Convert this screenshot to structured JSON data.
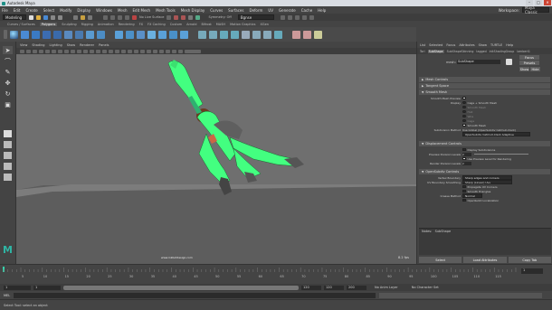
{
  "window": {
    "title": "Autodesk Maya",
    "min": "–",
    "max": "□",
    "close": "✕"
  },
  "menubar": {
    "items": [
      "File",
      "Edit",
      "Create",
      "Select",
      "Modify",
      "Display",
      "Windows",
      "Mesh",
      "Edit Mesh",
      "Mesh Tools",
      "Mesh Display",
      "Curves",
      "Surfaces",
      "Deform",
      "UV",
      "Generate",
      "Cache",
      "Help"
    ],
    "workspace_label": "Workspace:",
    "workspace_value": "Maya Classic"
  },
  "statusline": {
    "mode": "Modeling",
    "live_surface": "No Live Surface",
    "symmetry": "Symmetry: Off",
    "object_field": "Bgnse"
  },
  "shelf": {
    "tabs": [
      "Curves / Surfaces",
      "Polygons",
      "Sculpting",
      "Rigging",
      "Animation",
      "Rendering",
      "FX",
      "FX Caching",
      "Custom",
      "Arnold",
      "Bifrost",
      "MASH",
      "Motion Graphics",
      "XGen"
    ],
    "active_tab": 1
  },
  "panel": {
    "menu": [
      "View",
      "Shading",
      "Lighting",
      "Show",
      "Renderer",
      "Panels"
    ],
    "footer": "www.inkbotdesign.com",
    "fps": "8.2 fps"
  },
  "attribute_editor": {
    "top_tabs": [
      "List",
      "Selected",
      "Focus",
      "Attributes",
      "Show",
      "TURTLE",
      "Help"
    ],
    "node_tabs": [
      "Tori",
      "SubShape",
      "SubShapeSkinning",
      "tagged",
      "initShadingGroup",
      "lambert1"
    ],
    "active_node_tab": 1,
    "node_label": "mesh:",
    "node_name": "SubShape",
    "btn_focus": "Focus",
    "btn_presets": "Presets",
    "btn_show": "Show",
    "btn_hide": "Hide",
    "sections": {
      "mesh_controls": "Mesh Controls",
      "tangent_space": "Tangent Space",
      "smooth_mesh": "Smooth Mesh",
      "displacement": "Displacement Controls",
      "opensubdiv": "OpenSubdiv Controls"
    },
    "smooth": {
      "preview_label": "Smooth Mesh Preview",
      "display_label": "Display",
      "display_opt1": "Cage + Smooth Mesh",
      "display_opt2": "Smooth Mesh",
      "display_opt3": "Hull",
      "display_opt4": "Wire",
      "display_opt5": "Cage",
      "smooth_mesh_chk": "Smooth Mesh",
      "method_label": "Subdivision Method",
      "method_value": "Use Global (OpenSubdiv Catmull-Clark)",
      "method_select": "OpenSubdiv Catmull-Clark Adaptive"
    },
    "displ": {
      "chk1": "Display Subdivisions",
      "preview_label": "Preview Division Levels",
      "preview_value": "2",
      "chk2": "Use Preview Level for Rendering",
      "render_label": "Render Division Levels",
      "render_value": "2"
    },
    "osd": {
      "vb_label": "Vertex Boundary",
      "vb_value": "Sharp edges and corners",
      "fv_label": "UV Boundary Smoothing",
      "fv_value": "Sharp (Linear) Uvs",
      "chk1": "Propagate UV Corners",
      "chk2": "Smooth Triangles",
      "crease_label": "Crease Method",
      "crease_value": "Normal",
      "chk3": "OpenSubD Localization"
    },
    "notes_label": "Notes:",
    "notes_value": "SubShape",
    "bottom_select": "Select",
    "bottom_load": "Load Attributes",
    "bottom_copy": "Copy Tab"
  },
  "time": {
    "ticks": [
      "5",
      "10",
      "15",
      "20",
      "25",
      "30",
      "35",
      "40",
      "45",
      "50",
      "55",
      "60",
      "65",
      "70",
      "75",
      "80",
      "85",
      "90",
      "95",
      "100",
      "105",
      "110",
      "115"
    ],
    "current_frame": "1",
    "start": "1",
    "range_start": "1",
    "range_end": "120",
    "end": "120",
    "end2": "200",
    "anim_layer": "No Anim Layer",
    "char_set": "No Character Set",
    "mel": "MEL"
  },
  "help": "Select Tool: select an object",
  "colors": {
    "accent": "#2fb5a4",
    "char": "#43ff80",
    "close": "#c43"
  }
}
